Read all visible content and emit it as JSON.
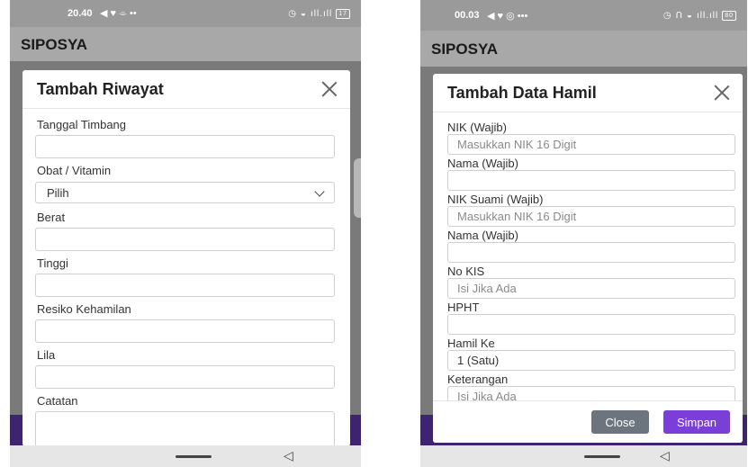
{
  "left": {
    "status": {
      "time": "20.40",
      "extra": "⌯ ••",
      "signal": "ıll.ıll",
      "battery": "17"
    },
    "app_title": "SIPOSYA",
    "modal": {
      "title": "Tambah Riwayat",
      "fields": [
        {
          "label": "Tanggal Timbang",
          "value": ""
        },
        {
          "label": "Obat / Vitamin",
          "type": "select",
          "value": "Pilih"
        },
        {
          "label": "Berat",
          "value": ""
        },
        {
          "label": "Tinggi",
          "value": ""
        },
        {
          "label": "Resiko Kehamilan",
          "value": ""
        },
        {
          "label": "Lila",
          "value": ""
        },
        {
          "label": "Catatan",
          "value": ""
        }
      ]
    }
  },
  "right": {
    "status": {
      "time": "00.03",
      "extra": "◎ •••",
      "signal": "ıll.ıll",
      "battery": "80"
    },
    "app_title": "SIPOSYA",
    "modal": {
      "title": "Tambah Data Hamil",
      "fields": [
        {
          "label": "NIK (Wajib)",
          "placeholder": "Masukkan NIK 16 Digit"
        },
        {
          "label": "Nama (Wajib)",
          "placeholder": ""
        },
        {
          "label": "NIK Suami (Wajib)",
          "placeholder": "Masukkan NIK 16 Digit"
        },
        {
          "label": "Nama (Wajib)",
          "placeholder": ""
        },
        {
          "label": "No KIS",
          "placeholder": "Isi Jika Ada"
        },
        {
          "label": "HPHT",
          "placeholder": ""
        },
        {
          "label": "Hamil Ke",
          "type": "select",
          "value": "1 (Satu)"
        },
        {
          "label": "Keterangan",
          "placeholder": "Isi Jika Ada"
        }
      ],
      "close_label": "Close",
      "save_label": "Simpan"
    }
  },
  "colors": {
    "primary": "#7a3fd8",
    "secondary": "#6c757d",
    "footer_purple": "#3e2470"
  }
}
